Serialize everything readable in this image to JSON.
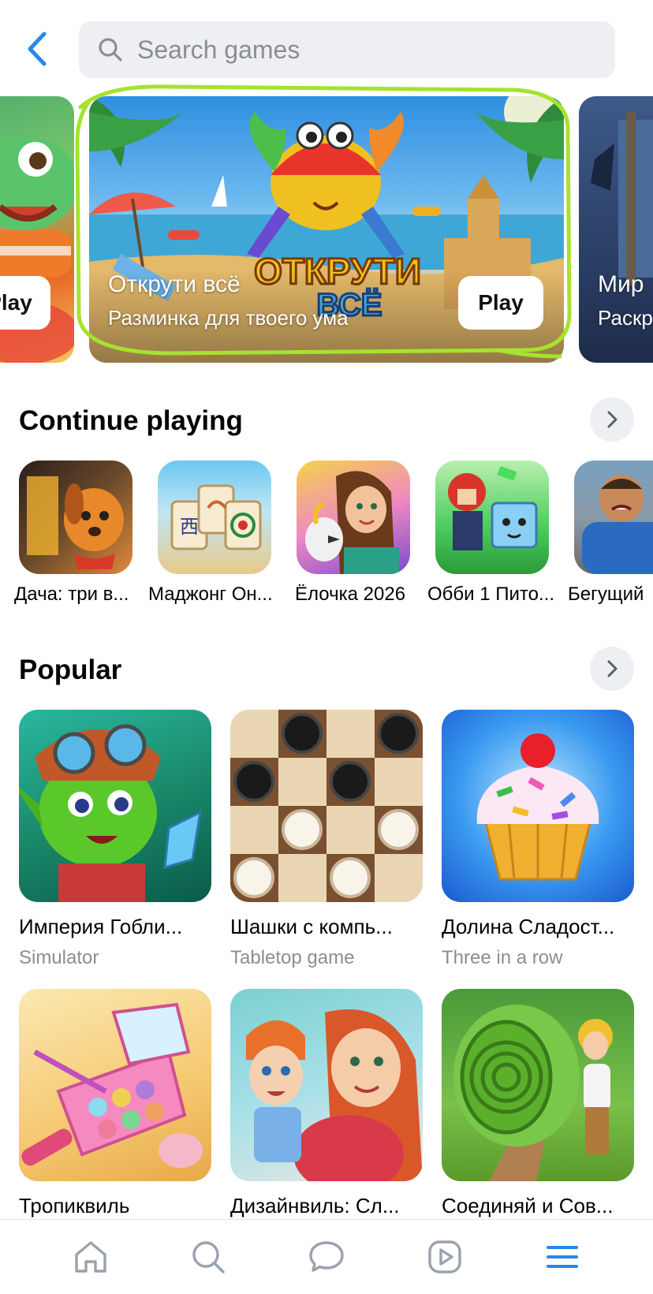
{
  "header": {
    "search_placeholder": "Search games"
  },
  "banners": [
    {
      "title": "",
      "subtitle": "",
      "play_label": "Play"
    },
    {
      "title": "Открути всё",
      "subtitle": "Разминка для твоего ума",
      "play_label": "Play",
      "logo_text": "ОТКРУТИ ВСЁ"
    },
    {
      "title": "Мир",
      "subtitle": "Раскр",
      "play_label": ""
    }
  ],
  "continue_playing": {
    "title": "Continue playing",
    "items": [
      {
        "label": "Дача: три в..."
      },
      {
        "label": "Маджонг Он..."
      },
      {
        "label": "Ёлочка 2026"
      },
      {
        "label": "Обби 1 Пито..."
      },
      {
        "label": "Бегущий"
      }
    ]
  },
  "popular": {
    "title": "Popular",
    "items": [
      {
        "name": "Империя Гобли...",
        "genre": "Simulator"
      },
      {
        "name": "Шашки с компь...",
        "genre": "Tabletop game"
      },
      {
        "name": "Долина Сладост...",
        "genre": "Three in a row"
      },
      {
        "name": "Тропиквиль",
        "genre": ""
      },
      {
        "name": "Дизайнвиль: Сл...",
        "genre": ""
      },
      {
        "name": "Соединяй и Сов...",
        "genre": ""
      }
    ]
  },
  "nav": {
    "items": [
      "home-icon",
      "search-icon",
      "chat-icon",
      "video-icon",
      "menu-icon"
    ],
    "active_color": "#2688eb",
    "inactive_color": "#99a2ad"
  },
  "colors": {
    "accent": "#2688eb",
    "highlight_outline": "#a6e22e"
  }
}
